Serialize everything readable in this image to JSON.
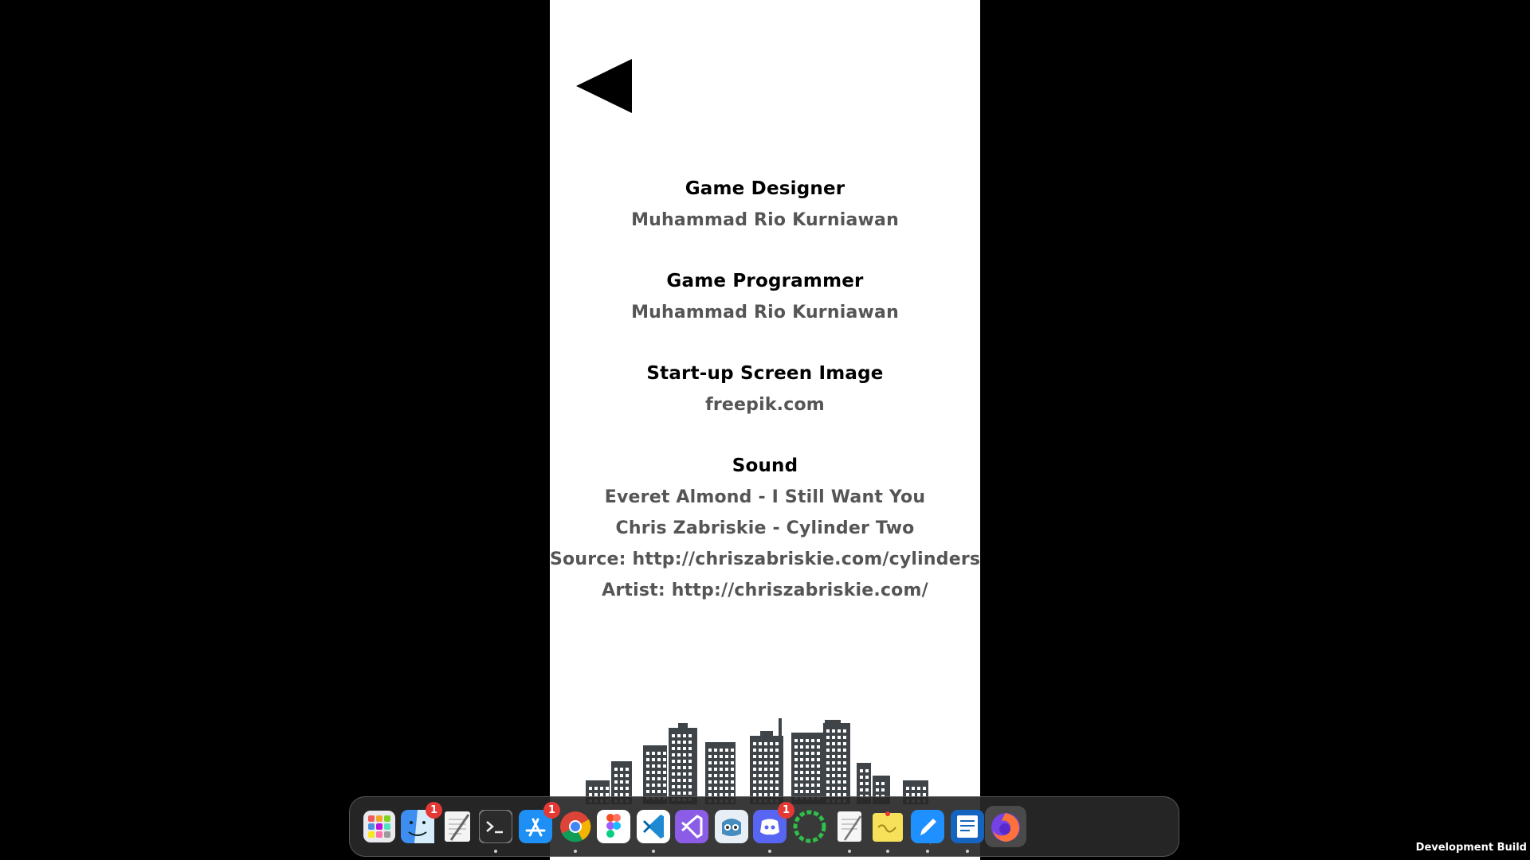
{
  "credits": [
    {
      "role": "Game Designer",
      "lines": [
        "Muhammad Rio Kurniawan"
      ]
    },
    {
      "role": "Game Programmer",
      "lines": [
        "Muhammad Rio Kurniawan"
      ]
    },
    {
      "role": "Start-up Screen Image",
      "lines": [
        "freepik.com"
      ]
    },
    {
      "role": "Sound",
      "lines": [
        "Everet Almond - I Still Want You",
        "Chris Zabriskie - Cylinder Two",
        "Source: http://chriszabriskie.com/cylinders/",
        "Artist: http://chriszabriskie.com/"
      ]
    }
  ],
  "dock": {
    "apps": [
      {
        "name": "launchpad-icon",
        "badge": ""
      },
      {
        "name": "finder-icon",
        "badge": "1"
      },
      {
        "name": "textedit-icon",
        "badge": ""
      },
      {
        "name": "terminal-icon",
        "badge": ""
      },
      {
        "name": "app-store-icon",
        "badge": "1"
      },
      {
        "name": "chrome-icon",
        "badge": ""
      },
      {
        "name": "figma-icon",
        "badge": ""
      },
      {
        "name": "vscode-icon",
        "badge": ""
      },
      {
        "name": "visual-studio-icon",
        "badge": ""
      },
      {
        "name": "godot-icon",
        "badge": ""
      },
      {
        "name": "discord-icon",
        "badge": "1"
      },
      {
        "name": "loading-ring-app-icon",
        "badge": ""
      },
      {
        "name": "notes-document-icon",
        "badge": ""
      },
      {
        "name": "stickies-icon",
        "badge": ""
      },
      {
        "name": "pencil-app-icon",
        "badge": ""
      },
      {
        "name": "document-viewer-icon",
        "badge": ""
      },
      {
        "name": "firefox-icon",
        "badge": ""
      }
    ]
  },
  "footer": {
    "dev_build_label": "Development Build"
  },
  "colors": {
    "panel_bg": "#ffffff",
    "role_text": "#000000",
    "name_text": "#555555",
    "building": "#3f4449"
  }
}
